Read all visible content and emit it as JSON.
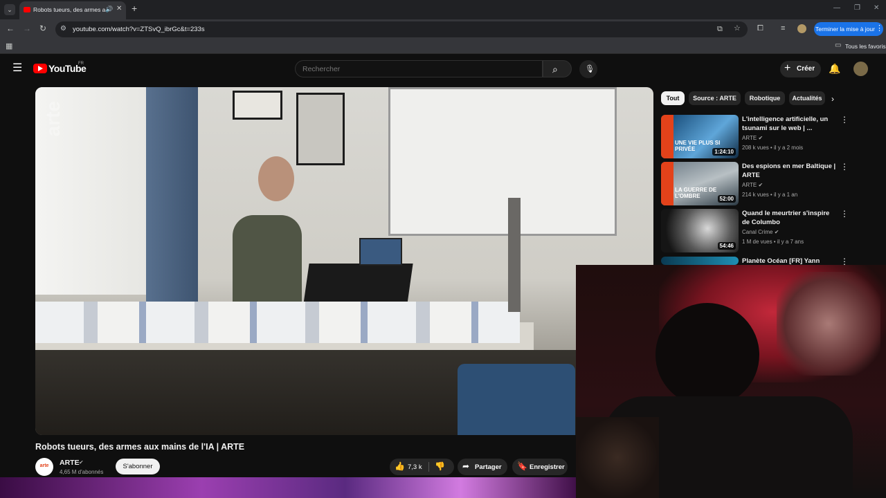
{
  "browser": {
    "tab": {
      "title": "Robots tueurs, des armes a",
      "audio": "🔊",
      "close": "✕"
    },
    "new_tab": "+",
    "window_controls": {
      "minimize": "—",
      "restore": "❐",
      "close": "✕"
    },
    "url": "youtube.com/watch?v=ZTSvQ_ibrGc&t=233s",
    "update_button": "Terminer la mise à jour",
    "bookmarks_all": "Tous les favoris"
  },
  "youtube": {
    "region": "FR",
    "wordmark": "YouTube",
    "search_placeholder": "Rechercher",
    "create_label": "Créer",
    "video": {
      "watermark": "arte",
      "title": "Robots tueurs, des armes aux mains de l'IA | ARTE",
      "channel": "ARTE",
      "channel_avatar_text": "arte",
      "subscribers": "4,65 M d'abonnés",
      "subscribe_label": "S'abonner",
      "likes": "7,3 k",
      "share_label": "Partager",
      "save_label": "Enregistrer"
    },
    "chips": [
      "Tout",
      "Source : ARTE",
      "Robotique",
      "Actualités"
    ],
    "recommendations": [
      {
        "title": "L'intelligence artificielle, un tsunami sur le web | ...",
        "channel": "ARTE",
        "verified": true,
        "meta": "208 k vues • il y a 2 mois",
        "duration": "1:24:10",
        "thumb_text": "UNE VIE PLUS SI PRIVÉE"
      },
      {
        "title": "Des espions en mer Baltique | ARTE",
        "channel": "ARTE",
        "verified": true,
        "meta": "214 k vues • il y a 1 an",
        "duration": "52:00",
        "thumb_text": "LA GUERRE DE L'OMBRE"
      },
      {
        "title": "Quand le meurtrier s'inspire de Columbo",
        "channel": "Canal Crime",
        "verified": true,
        "meta": "1 M de vues • il y a 7 ans",
        "duration": "54:46",
        "thumb_text": ""
      },
      {
        "title": "Planète Océan [FR] Yann",
        "channel": "",
        "verified": false,
        "meta": "",
        "duration": "",
        "thumb_text": ""
      }
    ]
  },
  "colors": {
    "accent": "#ff0000",
    "update_blue": "#1a73e8",
    "arte_orange": "#e3421a"
  }
}
